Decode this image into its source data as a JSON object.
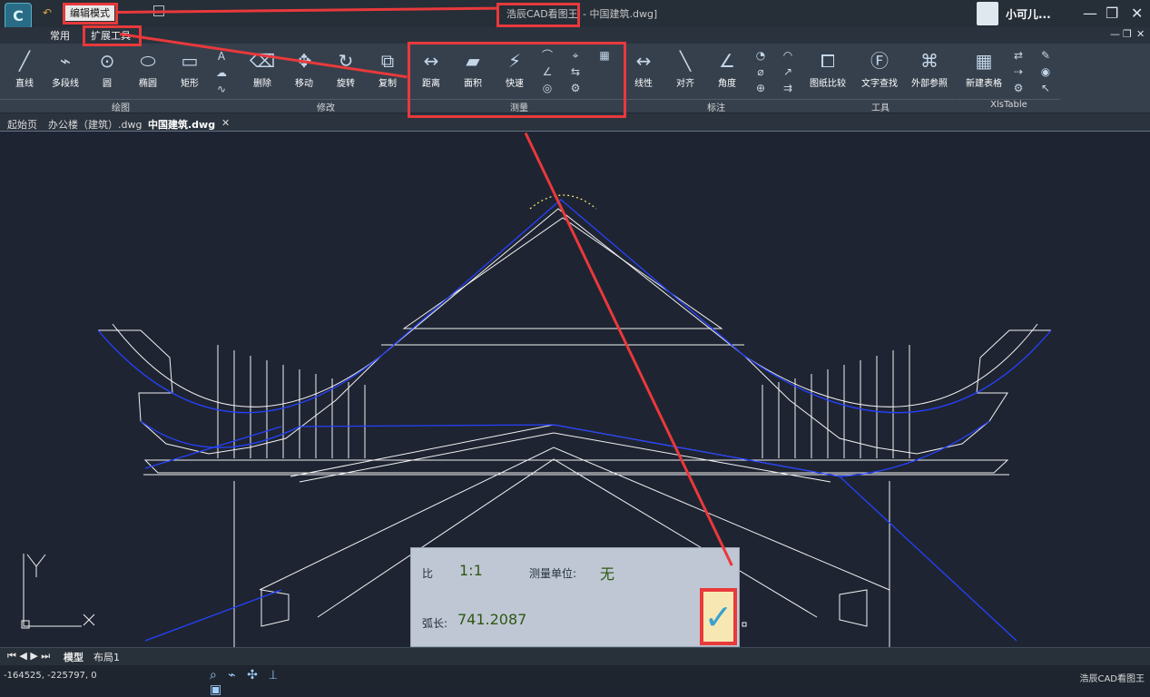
{
  "titlebar": {
    "mode_badge": "编辑模式",
    "app_title": "浩辰CAD看图王",
    "file_title": " - 中国建筑.dwg]",
    "user_name": "小可儿..."
  },
  "tabs": {
    "common": "常用",
    "expand": "扩展工具"
  },
  "ribbon": {
    "groups": {
      "draw": "绘图",
      "modify": "修改",
      "measure": "测量",
      "dimension": "标注",
      "tools": "工具",
      "xlstable": "XlsTable"
    },
    "tools": {
      "line": "直线",
      "polyline": "多段线",
      "circle": "圆",
      "ellipse": "椭圆",
      "rectangle": "矩形",
      "delete": "删除",
      "move": "移动",
      "rotate": "旋转",
      "copy": "复制",
      "distance": "距离",
      "area": "面积",
      "quick": "快速",
      "linear": "线性",
      "align": "对齐",
      "angle": "角度",
      "compare": "图纸比较",
      "text_find": "文字查找",
      "xref": "外部参照",
      "new_table": "新建表格"
    }
  },
  "document_tabs": {
    "start": "起始页",
    "office": "办公楼（建筑）.dwg",
    "current": "中国建筑.dwg"
  },
  "measure_panel": {
    "ratio_label": "比",
    "ratio_value": "1:1",
    "unit_label": "测量单位:",
    "unit_value": "无",
    "arc_label": "弧长:",
    "arc_value": "741.2087"
  },
  "axis": {
    "y": "Y",
    "x": "×"
  },
  "layout_tabs": {
    "model": "模型",
    "layout1": "布局1"
  },
  "status": {
    "coords": "-164525, -225797, 0",
    "app": "浩辰CAD看图王"
  },
  "colors": {
    "highlight_red": "#e8393b",
    "selected_outline": "#2442ff",
    "drawing_lines": "#f2f2f2",
    "check_blue": "#39a1d1"
  }
}
